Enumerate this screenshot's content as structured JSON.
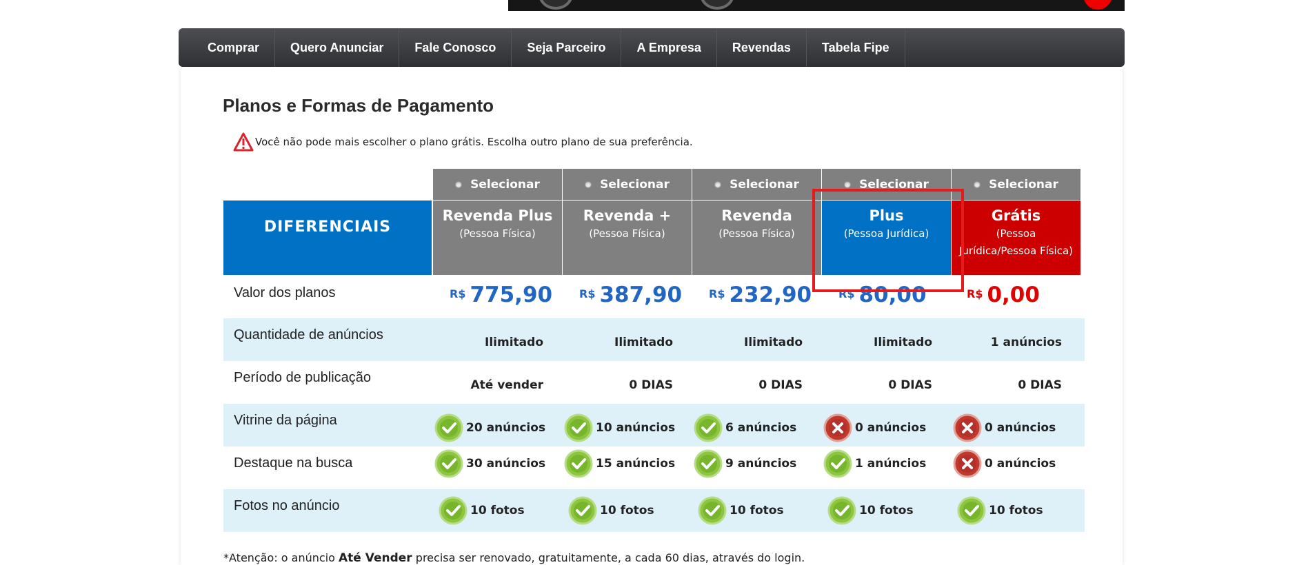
{
  "nav": {
    "items": [
      "Comprar",
      "Quero Anunciar",
      "Fale Conosco",
      "Seja Parceiro",
      "A Empresa",
      "Revendas",
      "Tabela Fipe"
    ]
  },
  "page": {
    "title": "Planos e Formas de Pagamento",
    "warning": "Você não pode mais escolher o plano grátis. Escolha outro plano de sua preferência.",
    "differentials_header": "DIFERENCIAIS",
    "select_label": "Selecionar",
    "currency": "R$",
    "note_prefix": "*Atenção: o anúncio ",
    "note_bold": "Até Vender",
    "note_suffix": " precisa ser renovado, gratuitamente, a cada 60 dias, através do login."
  },
  "rows": {
    "labels": [
      "Valor dos planos",
      "Quantidade de anúncios",
      "Período de publicação",
      "Vitrine da página",
      "Destaque na busca",
      "Fotos no anúncio"
    ]
  },
  "plans": [
    {
      "name": "Revenda Plus",
      "sub": "(Pessoa Física)",
      "price": "775,90",
      "qty": "Ilimitado",
      "period": "Até vender",
      "vitrine": "20 anúncios",
      "vitrine_ok": true,
      "destaque": "30 anúncios",
      "destaque_ok": true,
      "fotos": "10 fotos",
      "color": "#808080"
    },
    {
      "name": "Revenda +",
      "sub": "(Pessoa Física)",
      "price": "387,90",
      "qty": "Ilimitado",
      "period": "0 DIAS",
      "vitrine": "10 anúncios",
      "vitrine_ok": true,
      "destaque": "15 anúncios",
      "destaque_ok": true,
      "fotos": "10 fotos",
      "color": "#808080"
    },
    {
      "name": "Revenda",
      "sub": "(Pessoa Física)",
      "price": "232,90",
      "qty": "Ilimitado",
      "period": "0 DIAS",
      "vitrine": "6 anúncios",
      "vitrine_ok": true,
      "destaque": "9 anúncios",
      "destaque_ok": true,
      "fotos": "10 fotos",
      "color": "#808080"
    },
    {
      "name": "Plus",
      "sub": "(Pessoa Jurídica)",
      "price": "80,00",
      "qty": "Ilimitado",
      "period": "0 DIAS",
      "vitrine": "0 anúncios",
      "vitrine_ok": false,
      "destaque": "1 anúncios",
      "destaque_ok": true,
      "fotos": "10 fotos",
      "color": "#0071c5"
    },
    {
      "name": "Grátis",
      "sub": "(Pessoa Jurídica/Pessoa Física)",
      "price": "0,00",
      "qty": "1 anúncios",
      "period": "0 DIAS",
      "vitrine": "0 anúncios",
      "vitrine_ok": false,
      "destaque": "0 anúncios",
      "destaque_ok": false,
      "fotos": "10 fotos",
      "color": "#cc0000"
    }
  ],
  "colors": {
    "brand_blue": "#0071c5",
    "price_blue": "#2166c2",
    "price_red": "#e00000",
    "check_green": "#8cc63f",
    "cross_red": "#c0392b",
    "highlight": "#e31d1d"
  }
}
